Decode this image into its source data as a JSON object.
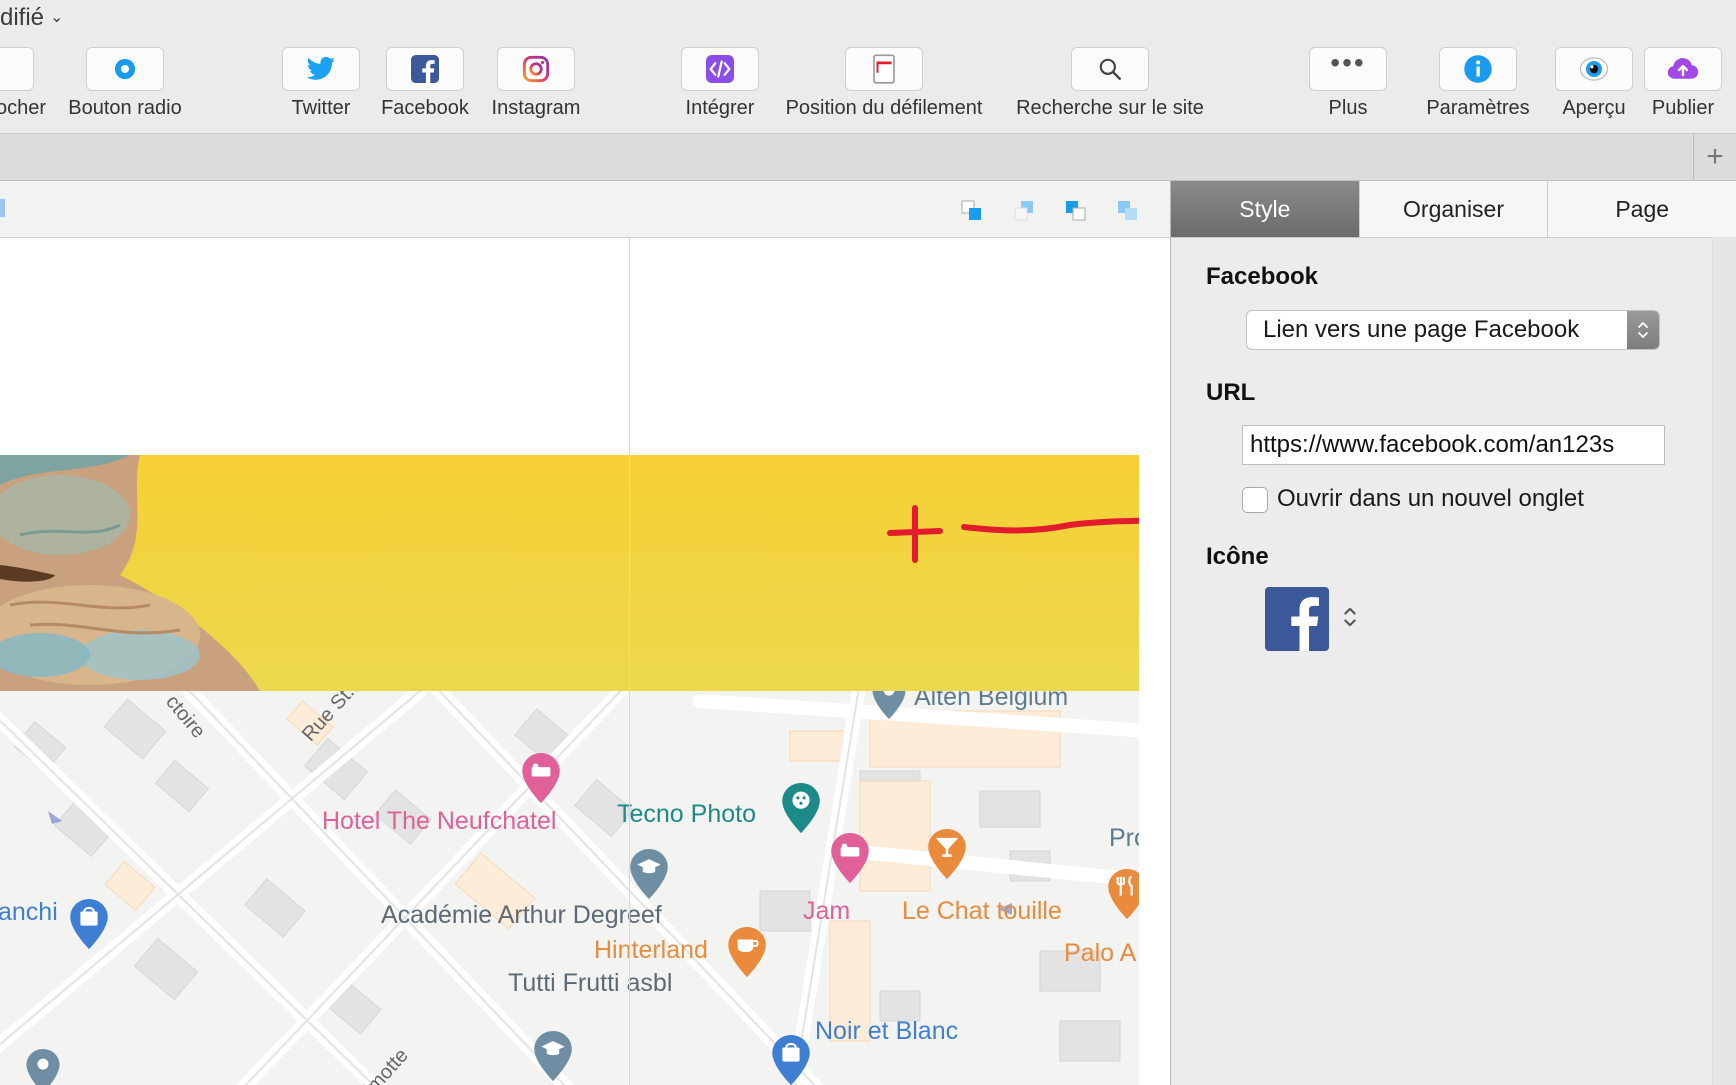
{
  "doc": {
    "title": "difié"
  },
  "toolbar": {
    "items": [
      {
        "id": "cocher",
        "label": "ocher",
        "icon": "checkbox-icon"
      },
      {
        "id": "bouton-radio",
        "label": "Bouton radio",
        "icon": "radio-button-icon"
      },
      {
        "id": "twitter",
        "label": "Twitter",
        "icon": "twitter-icon"
      },
      {
        "id": "facebook",
        "label": "Facebook",
        "icon": "facebook-icon"
      },
      {
        "id": "instagram",
        "label": "Instagram",
        "icon": "instagram-icon"
      },
      {
        "id": "integrer",
        "label": "Intégrer",
        "icon": "embed-code-icon"
      },
      {
        "id": "position",
        "label": "Position du défilement",
        "icon": "scroll-position-icon"
      },
      {
        "id": "recherche",
        "label": "Recherche sur le site",
        "icon": "search-icon"
      },
      {
        "id": "plus",
        "label": "Plus",
        "icon": "more-icon"
      },
      {
        "id": "parametres",
        "label": "Paramètres",
        "icon": "info-icon"
      },
      {
        "id": "apercu",
        "label": "Aperçu",
        "icon": "eye-icon"
      },
      {
        "id": "publier",
        "label": "Publier",
        "icon": "upload-cloud-icon"
      }
    ]
  },
  "inspector": {
    "tabs": [
      "Style",
      "Organiser",
      "Page"
    ],
    "active_tab": "Style",
    "facebook_heading": "Facebook",
    "link_type": "Lien vers une page Facebook",
    "url_heading": "URL",
    "url_value": "https://www.facebook.com/an123s",
    "open_new_tab_label": "Ouvrir dans un nouvel onglet",
    "open_new_tab_checked": false,
    "icon_heading": "Icône"
  },
  "map": {
    "labels": [
      "Alten Belgium",
      "Hotel The Neufchatel",
      "Tecno Photo",
      "Pro",
      "anchi",
      "Académie Arthur Degreef",
      "Jam",
      "Le Chat touille",
      "Hinterland",
      "Palo A",
      "Tutti Frutti asbl",
      "Noir et Blanc",
      "Rue St.Bern",
      "ctoire",
      "lmotte"
    ]
  },
  "colors": {
    "banner": "#f6d034",
    "facebook_blue": "#3b5998",
    "annotation_red": "#e21b2d",
    "hotel_pink": "#e0609a",
    "food_orange": "#e98a3c",
    "photo_teal": "#1d8a8a",
    "shop_blue": "#3f7fd3"
  }
}
